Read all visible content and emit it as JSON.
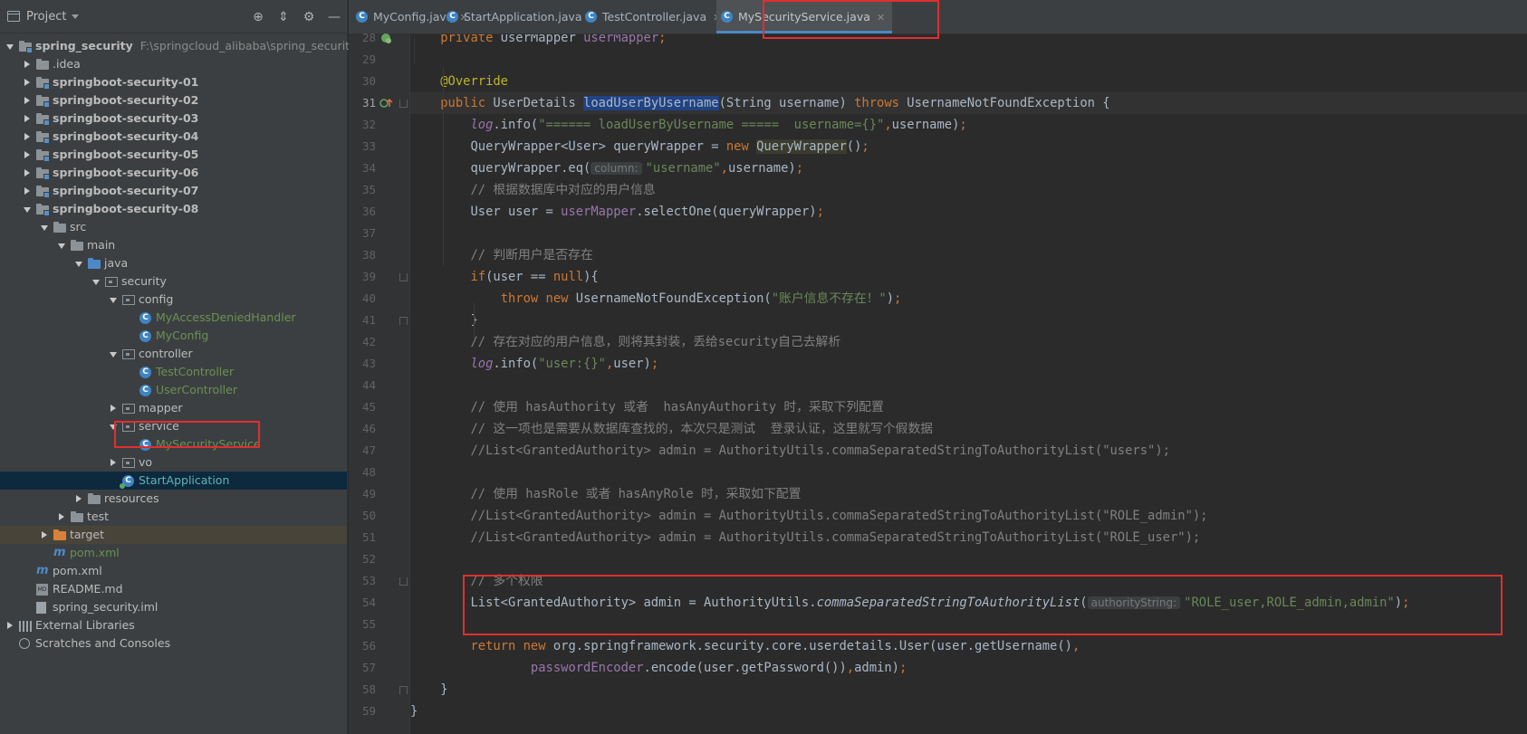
{
  "project_panel": {
    "title": "Project",
    "tree": [
      {
        "label": "spring_security",
        "path": "F:\\springcloud_alibaba\\spring_security",
        "depth": 0,
        "state": "exp",
        "icon": "folder-module-icon",
        "style": "bold"
      },
      {
        "label": ".idea",
        "depth": 1,
        "state": "col",
        "icon": "folder-icon",
        "style": "plain"
      },
      {
        "label": "springboot-security-01",
        "depth": 1,
        "state": "col",
        "icon": "folder-module-icon",
        "style": "bold"
      },
      {
        "label": "springboot-security-02",
        "depth": 1,
        "state": "col",
        "icon": "folder-module-icon",
        "style": "bold"
      },
      {
        "label": "springboot-security-03",
        "depth": 1,
        "state": "col",
        "icon": "folder-module-icon",
        "style": "bold"
      },
      {
        "label": "springboot-security-04",
        "depth": 1,
        "state": "col",
        "icon": "folder-module-icon",
        "style": "bold"
      },
      {
        "label": "springboot-security-05",
        "depth": 1,
        "state": "col",
        "icon": "folder-module-icon",
        "style": "bold"
      },
      {
        "label": "springboot-security-06",
        "depth": 1,
        "state": "col",
        "icon": "folder-module-icon",
        "style": "bold"
      },
      {
        "label": "springboot-security-07",
        "depth": 1,
        "state": "col",
        "icon": "folder-module-icon",
        "style": "bold"
      },
      {
        "label": "springboot-security-08",
        "depth": 1,
        "state": "exp",
        "icon": "folder-module-icon",
        "style": "bold"
      },
      {
        "label": "src",
        "depth": 2,
        "state": "exp",
        "icon": "folder-icon",
        "style": "plain"
      },
      {
        "label": "main",
        "depth": 3,
        "state": "exp",
        "icon": "folder-icon",
        "style": "plain"
      },
      {
        "label": "java",
        "depth": 4,
        "state": "exp",
        "icon": "source-folder-icon",
        "style": "plain"
      },
      {
        "label": "security",
        "depth": 5,
        "state": "exp",
        "icon": "package-icon",
        "style": "plain"
      },
      {
        "label": "config",
        "depth": 6,
        "state": "exp",
        "icon": "package-icon",
        "style": "plain"
      },
      {
        "label": "MyAccessDeniedHandler",
        "depth": 7,
        "state": "none",
        "icon": "class-icon",
        "style": "olive"
      },
      {
        "label": "MyConfig",
        "depth": 7,
        "state": "none",
        "icon": "class-icon",
        "style": "olive"
      },
      {
        "label": "controller",
        "depth": 6,
        "state": "exp",
        "icon": "package-icon",
        "style": "plain"
      },
      {
        "label": "TestController",
        "depth": 7,
        "state": "none",
        "icon": "class-icon",
        "style": "olive"
      },
      {
        "label": "UserController",
        "depth": 7,
        "state": "none",
        "icon": "class-icon",
        "style": "olive"
      },
      {
        "label": "mapper",
        "depth": 6,
        "state": "col",
        "icon": "package-icon",
        "style": "plain"
      },
      {
        "label": "service",
        "depth": 6,
        "state": "exp",
        "icon": "package-icon",
        "style": "plain"
      },
      {
        "label": "MySecurityService",
        "depth": 7,
        "state": "none",
        "icon": "class-icon",
        "style": "olive"
      },
      {
        "label": "vo",
        "depth": 6,
        "state": "col",
        "icon": "package-icon",
        "style": "plain"
      },
      {
        "label": "StartApplication",
        "depth": 6,
        "state": "none",
        "icon": "run-class-icon",
        "style": "teal",
        "selected": true
      },
      {
        "label": "resources",
        "depth": 4,
        "state": "col",
        "icon": "resources-folder-icon",
        "style": "plain"
      },
      {
        "label": "test",
        "depth": 3,
        "state": "col",
        "icon": "folder-icon",
        "style": "plain"
      },
      {
        "label": "target",
        "depth": 2,
        "state": "col",
        "icon": "excluded-folder-icon",
        "style": "plain",
        "target": true
      },
      {
        "label": "pom.xml",
        "depth": 2,
        "state": "none",
        "icon": "maven-icon",
        "style": "olive"
      },
      {
        "label": "pom.xml",
        "depth": 1,
        "state": "none",
        "icon": "maven-icon",
        "style": "plain"
      },
      {
        "label": "README.md",
        "depth": 1,
        "state": "none",
        "icon": "markdown-icon",
        "style": "plain"
      },
      {
        "label": "spring_security.iml",
        "depth": 1,
        "state": "none",
        "icon": "iml-file-icon",
        "style": "plain"
      },
      {
        "label": "External Libraries",
        "depth": 0,
        "state": "col",
        "icon": "library-icon",
        "style": "plain"
      },
      {
        "label": "Scratches and Consoles",
        "depth": 0,
        "state": "none",
        "icon": "scratch-icon",
        "style": "plain"
      }
    ]
  },
  "tabs": [
    {
      "label": "MyConfig.java",
      "active": false
    },
    {
      "label": "StartApplication.java",
      "active": false
    },
    {
      "label": "TestController.java",
      "active": false
    },
    {
      "label": "MySecurityService.java",
      "active": true
    }
  ],
  "editor": {
    "current_line": 31,
    "lines": [
      {
        "n": 28,
        "html": "    <span class=\"kw\">private</span> UserMapper <span class=\"fld\">userMapper</span><span class=\"kw\">;</span>"
      },
      {
        "n": 29,
        "html": ""
      },
      {
        "n": 30,
        "html": "    <span class=\"ann\">@Override</span>"
      },
      {
        "n": 31,
        "html": "    <span class=\"kw\">public</span> UserDetails <span class=\"hl\">loadUserByUsername</span>(String username) <span class=\"kw\">throws</span> UsernameNotFoundException {"
      },
      {
        "n": 32,
        "html": "        <span class=\"log\">log</span>.info(<span class=\"str\">\"====== loadUserByUsername =====  username={}\"</span><span class=\"kw\">,</span>username)<span class=\"kw\">;</span>"
      },
      {
        "n": 33,
        "html": "        QueryWrapper&lt;User&gt; queryWrapper = <span class=\"kw\">new</span> <span class=\"hl2\">QueryWrapper</span>()<span class=\"kw\">;</span>"
      },
      {
        "n": 34,
        "html": "        queryWrapper.eq(<span class=\"hint\">column:</span><span class=\"str\">\"username\"</span><span class=\"kw\">,</span>username)<span class=\"kw\">;</span>"
      },
      {
        "n": 35,
        "html": "        <span class=\"com\">// 根据数据库中对应的用户信息</span>"
      },
      {
        "n": 36,
        "html": "        User user = <span class=\"fld\">userMapper</span>.selectOne(queryWrapper)<span class=\"kw\">;</span>"
      },
      {
        "n": 37,
        "html": ""
      },
      {
        "n": 38,
        "html": "        <span class=\"com\">// 判断用户是否存在</span>"
      },
      {
        "n": 39,
        "html": "        <span class=\"kw\">if</span>(user == <span class=\"kw\">null</span>){"
      },
      {
        "n": 40,
        "html": "            <span class=\"kw\">throw new</span> UsernameNotFoundException(<span class=\"str\">\"账户信息不存在！\"</span>)<span class=\"kw\">;</span>"
      },
      {
        "n": 41,
        "html": "        }"
      },
      {
        "n": 42,
        "html": "        <span class=\"com\">// 存在对应的用户信息，则将其封装，丢给security自己去解析</span>"
      },
      {
        "n": 43,
        "html": "        <span class=\"log\">log</span>.info(<span class=\"str\">\"user:{}\"</span><span class=\"kw\">,</span>user)<span class=\"kw\">;</span>"
      },
      {
        "n": 44,
        "html": ""
      },
      {
        "n": 45,
        "html": "        <span class=\"com\">// 使用 hasAuthority 或者  hasAnyAuthority 时，采取下列配置</span>"
      },
      {
        "n": 46,
        "html": "        <span class=\"com\">// 这一项也是需要从数据库查找的，本次只是测试  登录认证，这里就写个假数据</span>"
      },
      {
        "n": 47,
        "html": "        <span class=\"com\">//List&lt;GrantedAuthority&gt; admin = AuthorityUtils.commaSeparatedStringToAuthorityList(\"users\");</span>"
      },
      {
        "n": 48,
        "html": ""
      },
      {
        "n": 49,
        "html": "        <span class=\"com\">// 使用 hasRole 或者 hasAnyRole 时，采取如下配置</span>"
      },
      {
        "n": 50,
        "html": "        <span class=\"com\">//List&lt;GrantedAuthority&gt; admin = AuthorityUtils.commaSeparatedStringToAuthorityList(\"ROLE_admin\");</span>"
      },
      {
        "n": 51,
        "html": "        <span class=\"com\">//List&lt;GrantedAuthority&gt; admin = AuthorityUtils.commaSeparatedStringToAuthorityList(\"ROLE_user\");</span>"
      },
      {
        "n": 52,
        "html": ""
      },
      {
        "n": 53,
        "html": "        <span class=\"com\">// 多个权限</span>"
      },
      {
        "n": 54,
        "html": "        List&lt;GrantedAuthority&gt; admin = AuthorityUtils.<span class=\"mth-it\">commaSeparatedStringToAuthorityList</span>(<span class=\"hint\">authorityString:</span><span class=\"str\">\"ROLE_user,ROLE_admin,admin\"</span>)<span class=\"kw\">;</span>"
      },
      {
        "n": 55,
        "html": ""
      },
      {
        "n": 56,
        "html": "        <span class=\"kw\">return new</span> org.springframework.security.core.userdetails.User(user.getUsername()<span class=\"kw\">,</span>"
      },
      {
        "n": 57,
        "html": "                <span class=\"fld\">passwordEncoder</span>.encode(user.getPassword())<span class=\"kw\">,</span>admin)<span class=\"kw\">;</span>"
      },
      {
        "n": 58,
        "html": "    }"
      },
      {
        "n": 59,
        "html": "}"
      }
    ]
  },
  "colors": {
    "highlight_box": "#e02f2f",
    "selection": "#0d293e",
    "accent": "#4a88c7"
  }
}
